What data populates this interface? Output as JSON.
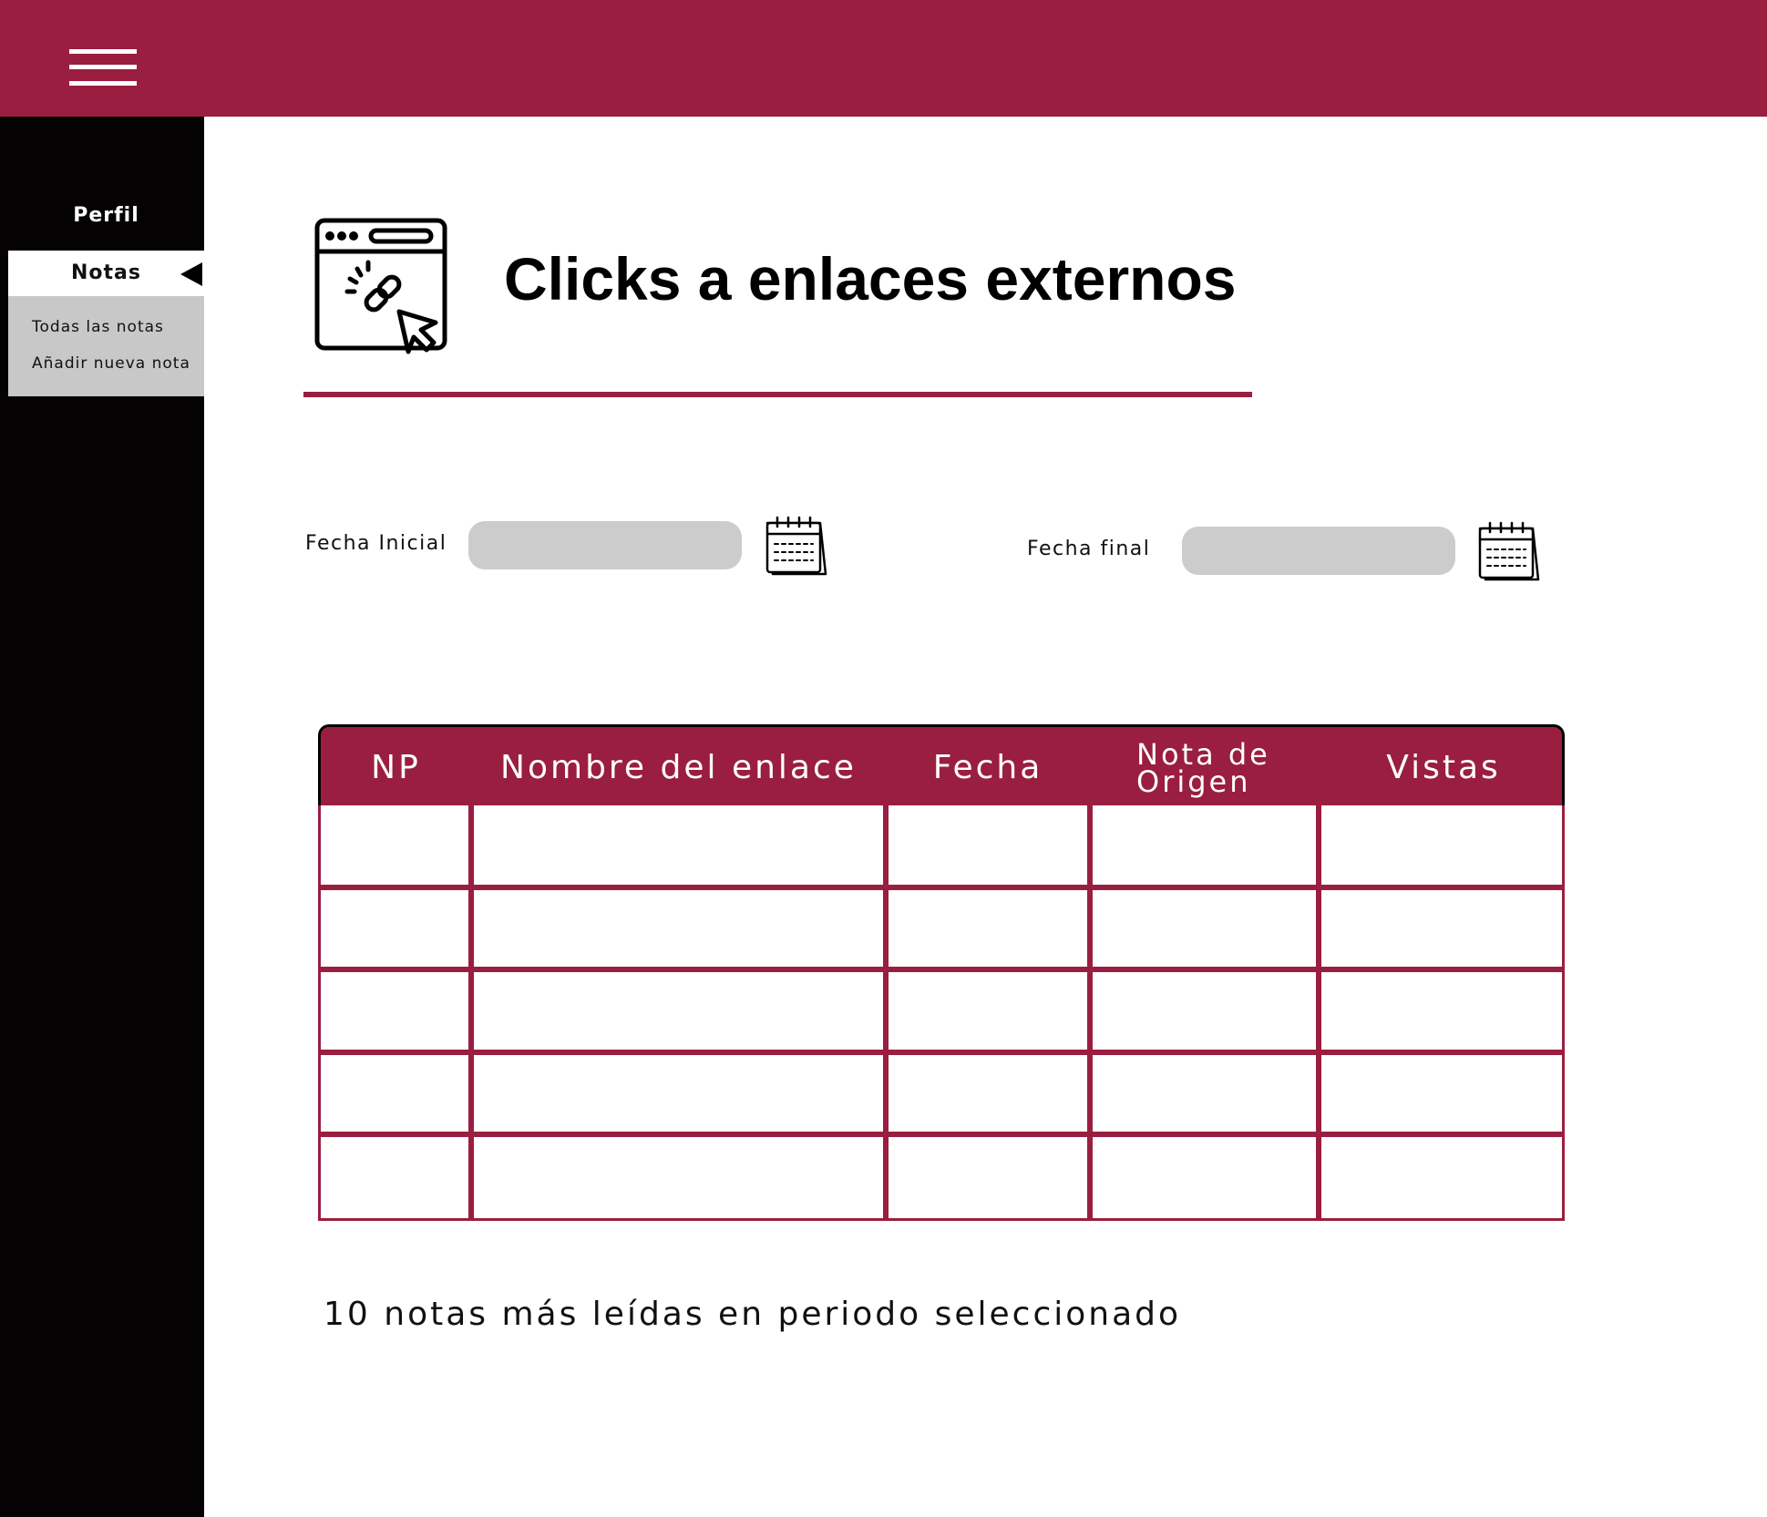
{
  "sidebar": {
    "items": [
      {
        "label": "Perfil"
      },
      {
        "label": "Notas"
      }
    ],
    "submenu": [
      {
        "label": "Todas las notas"
      },
      {
        "label": "Añadir nueva nota"
      }
    ]
  },
  "header": {
    "title": "Clicks a enlaces externos",
    "icon": "browser-link-click-icon"
  },
  "filters": {
    "start_label": "Fecha Inicial",
    "start_value": "",
    "end_label": "Fecha final",
    "end_value": ""
  },
  "table": {
    "columns": [
      "NP",
      "Nombre del enlace",
      "Fecha",
      "Nota de Origen",
      "Vistas"
    ],
    "rows": [
      [
        "",
        "",
        "",
        "",
        ""
      ],
      [
        "",
        "",
        "",
        "",
        ""
      ],
      [
        "",
        "",
        "",
        "",
        ""
      ],
      [
        "",
        "",
        "",
        "",
        ""
      ],
      [
        "",
        "",
        "",
        "",
        ""
      ]
    ]
  },
  "caption": "10 notas más leídas en periodo seleccionado",
  "colors": {
    "brand": "#9a1e40",
    "sidebar": "#050203",
    "submenu": "#c8c8c8",
    "input": "#cccccc"
  }
}
